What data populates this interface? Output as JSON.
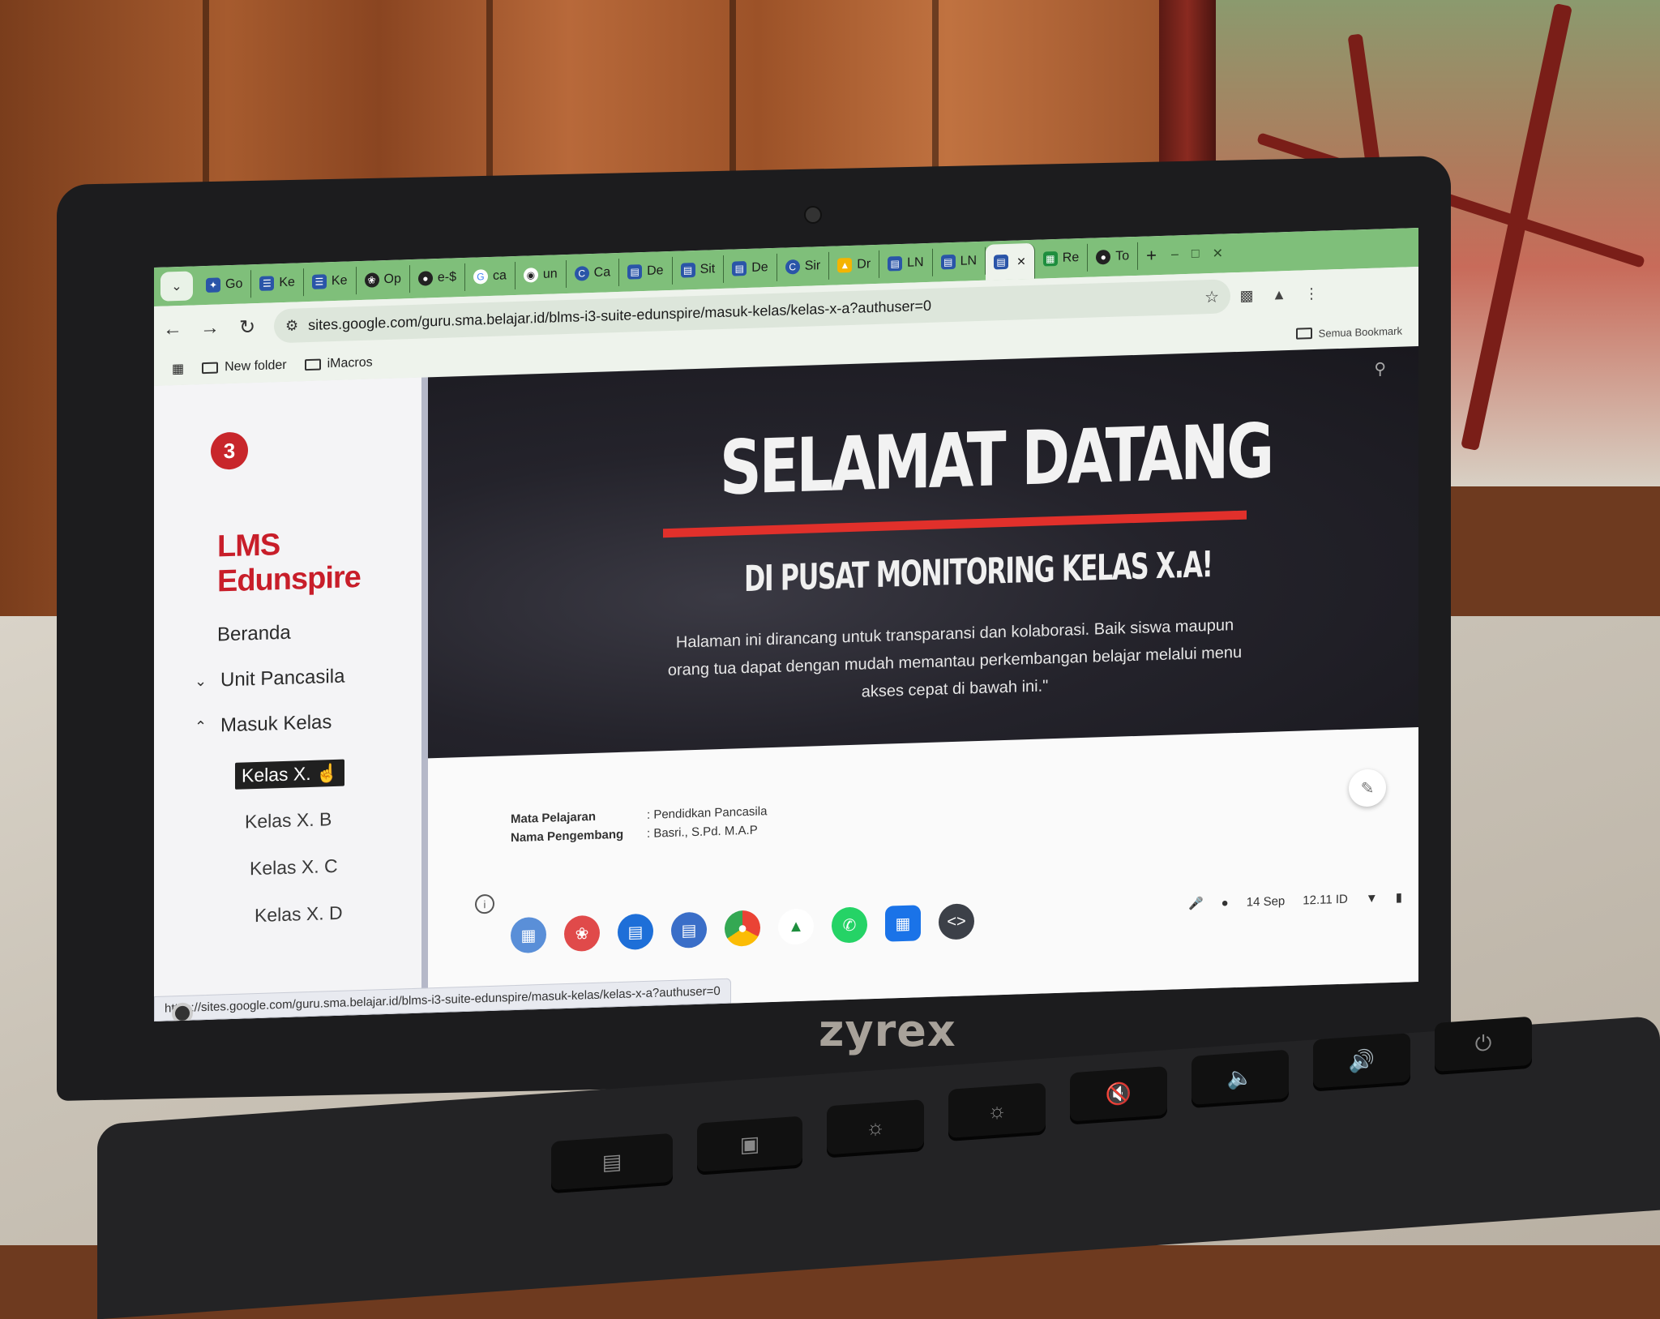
{
  "device": {
    "brand": "zyrex"
  },
  "browser": {
    "tabs": [
      {
        "label": "Go",
        "icon": "sparkle-icon"
      },
      {
        "label": "Ke",
        "icon": "sheet-icon"
      },
      {
        "label": "Ke",
        "icon": "sheet-icon"
      },
      {
        "label": "Op",
        "icon": "openai-icon"
      },
      {
        "label": "e-$",
        "icon": "globe-icon"
      },
      {
        "label": "ca",
        "icon": "google-icon"
      },
      {
        "label": "un",
        "icon": "github-icon"
      },
      {
        "label": "Ca",
        "icon": "c-icon"
      },
      {
        "label": "De",
        "icon": "page-icon"
      },
      {
        "label": "Sit",
        "icon": "page-icon"
      },
      {
        "label": "De",
        "icon": "page-icon"
      },
      {
        "label": "Sir",
        "icon": "c-icon"
      },
      {
        "label": "Dr",
        "icon": "drive-icon"
      },
      {
        "label": "LN",
        "icon": "page-icon"
      },
      {
        "label": "LN",
        "icon": "page-icon"
      },
      {
        "label": "",
        "icon": "page-icon",
        "active": true
      },
      {
        "label": "Re",
        "icon": "table-icon"
      },
      {
        "label": "To",
        "icon": "globe-icon"
      }
    ],
    "url": "sites.google.com/guru.sma.belajar.id/blms-i3-suite-edunspire/masuk-kelas/kelas-x-a?authuser=0",
    "bookmarks": [
      {
        "label": "New folder"
      },
      {
        "label": "iMacros"
      }
    ],
    "all_bookmarks_label": "Semua Bookmark"
  },
  "site": {
    "title": "LMS Edunspire",
    "nav": {
      "beranda": "Beranda",
      "unit_pancasila": "Unit Pancasila",
      "masuk_kelas": "Masuk Kelas",
      "kelas": [
        "Kelas X. A",
        "Kelas X. B",
        "Kelas X. C",
        "Kelas X. D"
      ],
      "active_kelas_label": "Kelas X."
    },
    "hero": {
      "title": "SELAMAT DATANG",
      "subtitle": "DI PUSAT MONITORING KELAS X.A!",
      "body": "Halaman ini dirancang untuk transparansi dan kolaborasi. Baik siswa maupun orang tua dapat dengan mudah memantau perkembangan belajar melalui menu akses cepat di bawah ini.\"",
      "accent": "#e1302b"
    },
    "info": {
      "mapel_label": "Mata Pelajaran",
      "mapel_value": ": Pendidkan Pancasila",
      "pengembang_label": "Nama Pengembang",
      "pengembang_value": ": Basri., S.Pd. M.A.P"
    },
    "status_url": "https://sites.google.com/guru.sma.belajar.id/blms-i3-suite-edunspire/masuk-kelas/kelas-x-a?authuser=0"
  },
  "shelf": {
    "apps": [
      "files-icon",
      "paint-icon",
      "classroom-icon",
      "book-icon",
      "chrome-icon",
      "drive-icon",
      "whatsapp-icon",
      "folder-icon",
      "code-icon"
    ],
    "date": "14 Sep",
    "time": "12.11 ID"
  }
}
